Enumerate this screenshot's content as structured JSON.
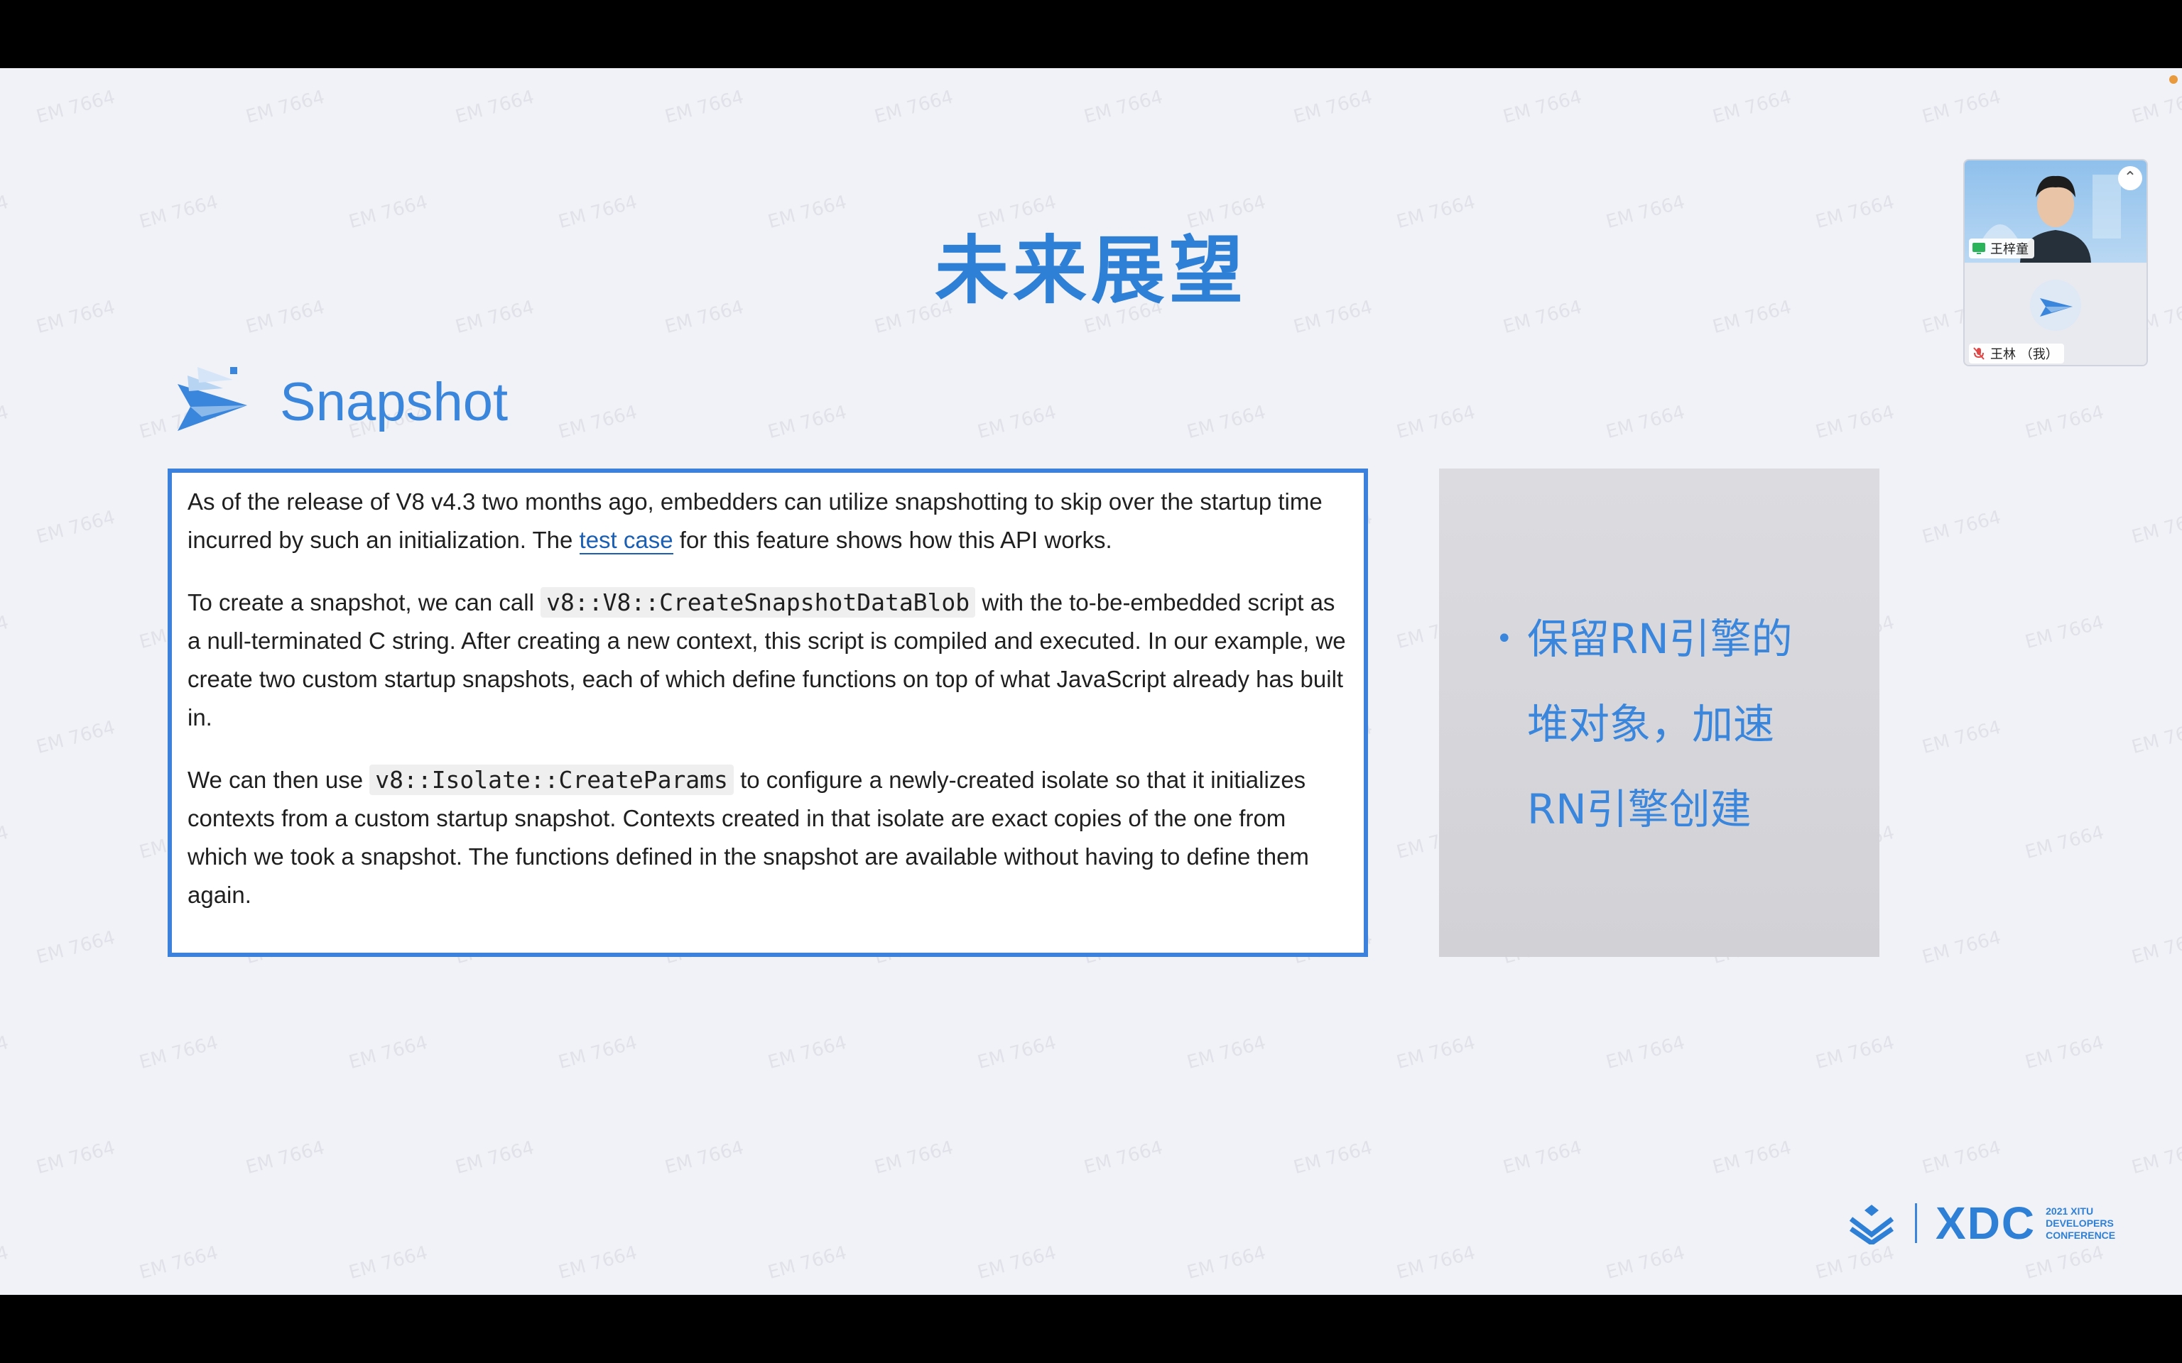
{
  "slide": {
    "title": "未来展望",
    "section_heading": "Snapshot",
    "watermark_text": "EM 7664"
  },
  "doc_excerpt": {
    "p1_before_link": "As of the release of V8 v4.3 two months ago, embedders can utilize snapshotting to skip over the startup time incurred by such an initialization. The ",
    "p1_link": "test case",
    "p1_after_link": " for this feature shows how this API works.",
    "p2_before_code": "To create a snapshot, we can call ",
    "p2_code": "v8::V8::CreateSnapshotDataBlob",
    "p2_after_code": " with the to-be-embedded script as a null-terminated C string. After creating a new context, this script is compiled and executed. In our example, we create two custom startup snapshots, each of which define functions on top of what JavaScript already has built in.",
    "p3_before_code": "We can then use ",
    "p3_code": "v8::Isolate::CreateParams",
    "p3_after_code": " to configure a newly-created isolate so that it initializes contexts from a custom startup snapshot. Contexts created in that isolate are exact copies of the one from which we took a snapshot. The functions defined in the snapshot are available without having to define them again."
  },
  "side_card": {
    "bullet": "•",
    "lines": [
      "保留RN引擎的",
      "堆对象，加速",
      "RN引擎创建"
    ]
  },
  "footer_logo": {
    "brand": "XDC",
    "sub_lines": [
      "2021 XITU",
      "DEVELOPERS",
      "CONFERENCE"
    ]
  },
  "video_panel": {
    "participants": [
      {
        "name": "王梓童",
        "icon": "screen-share-icon"
      },
      {
        "name": "王林 （我）",
        "icon": "mic-muted-icon"
      }
    ],
    "collapse_label": "⌃"
  },
  "colors": {
    "accent": "#2e7fd6",
    "box_border": "#3c82dc",
    "link": "#1a5fb4",
    "status_dot": "#e89a3c"
  }
}
